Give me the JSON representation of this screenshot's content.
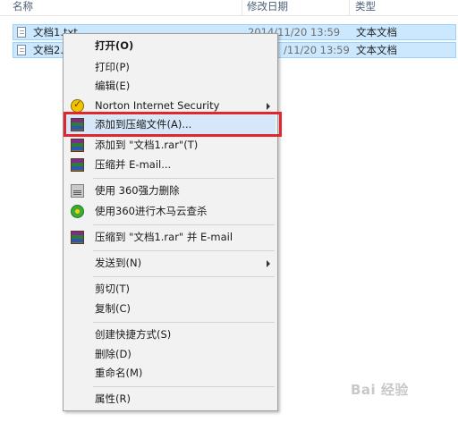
{
  "header": {
    "col_name": "名称",
    "col_modified": "修改日期",
    "col_type": "类型"
  },
  "files": [
    {
      "name": "文档1.txt",
      "modified": "2014/11/20 13:59",
      "type": "文本文档"
    },
    {
      "name": "文档2.",
      "modified": "/11/20 13:59",
      "type": "文本文档"
    }
  ],
  "menu": {
    "items": [
      {
        "label": "打开(O)",
        "icon": "none"
      },
      {
        "label": "打印(P)",
        "icon": "none"
      },
      {
        "label": "编辑(E)",
        "icon": "none"
      },
      {
        "label": "Norton Internet Security",
        "icon": "norton-icon",
        "submenu": true
      },
      {
        "label": "添加到压缩文件(A)...",
        "icon": "winrar-icon",
        "highlighted": true
      },
      {
        "label": "添加到 \"文档1.rar\"(T)",
        "icon": "winrar-icon"
      },
      {
        "label": "压缩并 E-mail...",
        "icon": "winrar-icon"
      },
      {
        "label": "使用 360强力删除",
        "icon": "shredder-icon"
      },
      {
        "label": "使用360进行木马云查杀",
        "icon": "360-icon"
      },
      {
        "label": "压缩到 \"文档1.rar\" 并 E-mail",
        "icon": "winrar-icon"
      },
      {
        "label": "发送到(N)",
        "icon": "none",
        "submenu": true
      },
      {
        "label": "剪切(T)",
        "icon": "none"
      },
      {
        "label": "复制(C)",
        "icon": "none"
      },
      {
        "label": "创建快捷方式(S)",
        "icon": "none"
      },
      {
        "label": "删除(D)",
        "icon": "none"
      },
      {
        "label": "重命名(M)",
        "icon": "none"
      },
      {
        "label": "属性(R)",
        "icon": "none"
      }
    ]
  },
  "watermark": "Bai 经验",
  "colors": {
    "selection_bg": "#cce8ff",
    "menu_highlight": "#d5e7f8",
    "annotation_red": "#e0262e"
  }
}
